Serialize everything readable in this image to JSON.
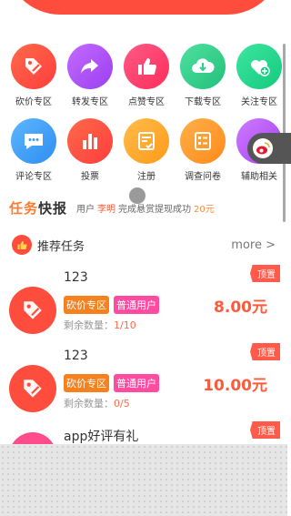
{
  "categories": [
    {
      "label": "砍价专区",
      "icon": "tag-icon",
      "color": "#ff4d3d"
    },
    {
      "label": "转发专区",
      "icon": "share-arrow-icon",
      "color": "#a855f7"
    },
    {
      "label": "点赞专区",
      "icon": "thumbs-up-icon",
      "color": "#ff3d6b"
    },
    {
      "label": "下载专区",
      "icon": "cloud-download-icon",
      "color": "#2fcf8e"
    },
    {
      "label": "关注专区",
      "icon": "heart-plus-icon",
      "color": "#1ed68a"
    },
    {
      "label": "评论专区",
      "icon": "chat-bubble-icon",
      "color": "#3a9cf5"
    },
    {
      "label": "投票",
      "icon": "bar-chart-icon",
      "color": "#ff4d3d"
    },
    {
      "label": "注册",
      "icon": "form-check-icon",
      "color": "#ffa428"
    },
    {
      "label": "调查问卷",
      "icon": "survey-list-icon",
      "color": "#ff9a2a"
    },
    {
      "label": "辅助相关",
      "icon": "assist-icon",
      "color": "#b85cf5"
    }
  ],
  "news": {
    "logo_a": "任务",
    "logo_b": "快报",
    "prefix": "用户",
    "user": "李明",
    "text": "完成悬赏提现成功",
    "amount": "20元"
  },
  "section": {
    "title": "推荐任务",
    "more": "more >"
  },
  "tasks": [
    {
      "title": "123",
      "tag1": "砍价专区",
      "tag2": "普通用户",
      "remain_label": "剩余数量：",
      "remain_value": "1/10",
      "price": "8.00元",
      "pin": "顶置"
    },
    {
      "title": "123",
      "tag1": "砍价专区",
      "tag2": "普通用户",
      "remain_label": "剩余数量：",
      "remain_value": "0/5",
      "price": "10.00元",
      "pin": "顶置"
    },
    {
      "title": "app好评有礼",
      "pin": "顶置"
    }
  ]
}
